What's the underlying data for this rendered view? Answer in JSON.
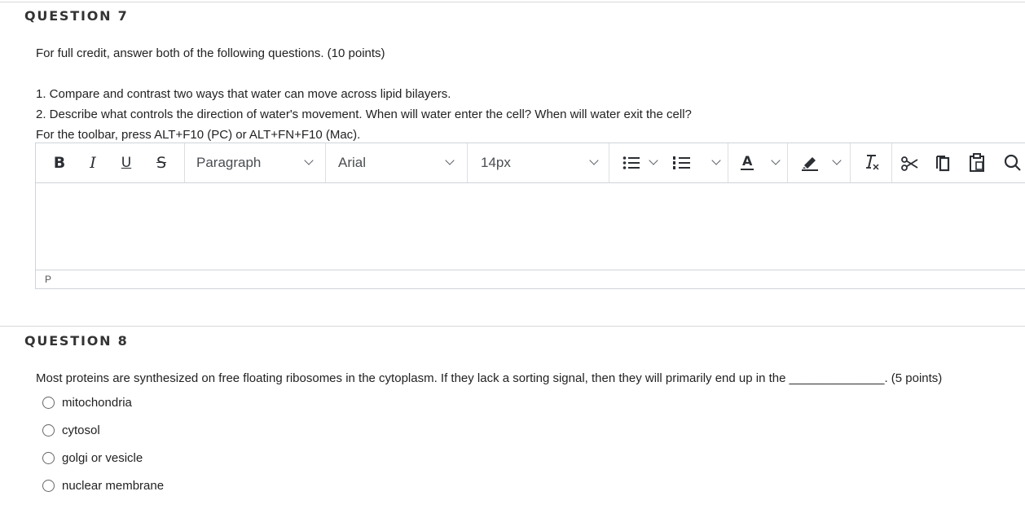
{
  "question7": {
    "title": "QUESTION 7",
    "intro": "For full credit, answer both of the following questions. (10 points)",
    "line1": "1. Compare and contrast two ways that water can move across lipid bilayers.",
    "line2": "2. Describe what controls the direction of water's movement. When will water enter the cell? When will water exit the cell?",
    "toolbar_hint": "For the toolbar, press ALT+F10 (PC) or ALT+FN+F10 (Mac).",
    "editor": {
      "paragraph_label": "Paragraph",
      "font_label": "Arial",
      "size_label": "14px",
      "status_path": "P",
      "icons": [
        "bold-icon",
        "italic-icon",
        "underline-icon",
        "strikethrough-icon",
        "bullet-list-icon",
        "numbered-list-icon",
        "text-color-icon",
        "highlight-icon",
        "clear-format-icon",
        "cut-icon",
        "copy-icon",
        "paste-icon",
        "search-icon"
      ],
      "bold_glyph": "B",
      "italic_glyph": "I",
      "underline_glyph": "U",
      "strike_glyph": "S",
      "textcolor_glyph": "A"
    }
  },
  "question8": {
    "title": "QUESTION 8",
    "prompt": "Most proteins are synthesized on free floating ribosomes in the cytoplasm. If they lack a sorting signal, then they will primarily end up in the",
    "blank": "______________",
    "points": ". (5 points)",
    "options": [
      "mitochondria",
      "cytosol",
      "golgi or vesicle",
      "nuclear membrane"
    ]
  },
  "colors": {
    "divider": "#d8d8d8",
    "text": "#222222",
    "border": "#cfd3d8"
  }
}
